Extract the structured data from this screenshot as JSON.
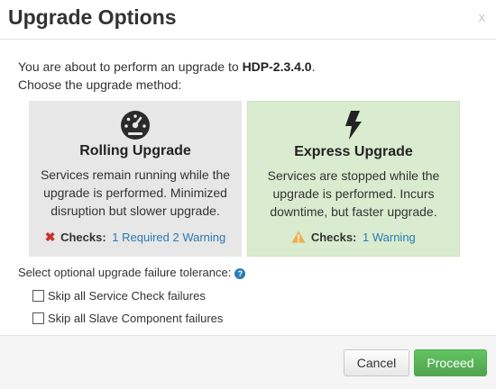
{
  "dialog": {
    "title": "Upgrade Options",
    "close_label": "x"
  },
  "intro": {
    "line1_prefix": "You are about to perform an upgrade to ",
    "version": "HDP-2.3.4.0",
    "line1_suffix": ".",
    "line2": "Choose the upgrade method:"
  },
  "options": [
    {
      "icon": "dashboard-gauge-icon",
      "title": "Rolling Upgrade",
      "description": "Services remain running while the upgrade is performed. Minimized disruption but slower upgrade.",
      "checks_icon": "x-icon",
      "checks_label": "Checks:",
      "checks_link": "1 Required 2 Warning",
      "background": "#e7e7e7"
    },
    {
      "icon": "bolt-icon",
      "title": "Express Upgrade",
      "description": "Services are stopped while the upgrade is performed. Incurs downtime, but faster upgrade.",
      "checks_icon": "warning-icon",
      "checks_label": "Checks:",
      "checks_link": "1 Warning",
      "background": "#daeccf",
      "selected": true
    }
  ],
  "tolerance": {
    "label": "Select optional upgrade failure tolerance:",
    "help_icon": "question-circle-icon",
    "checkboxes": [
      {
        "label": "Skip all Service Check failures",
        "checked": false
      },
      {
        "label": "Skip all Slave Component failures",
        "checked": false
      }
    ]
  },
  "footer": {
    "cancel_label": "Cancel",
    "proceed_label": "Proceed"
  },
  "colors": {
    "link": "#2a7ab5",
    "proceed_button": "#5cb85c",
    "error": "#c9302c",
    "warning": "#f0ad4e"
  }
}
